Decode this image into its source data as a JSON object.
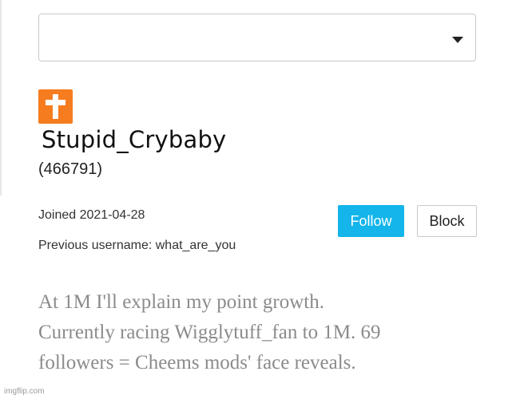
{
  "dropdown": {
    "value": ""
  },
  "profile": {
    "avatar_icon": "cross-icon",
    "avatar_color": "#f57c1f",
    "username": "Stupid_Crybaby",
    "user_id": "(466791)",
    "joined": "Joined 2021-04-28",
    "previous_username": "Previous username: what_are_you"
  },
  "actions": {
    "follow_label": "Follow",
    "follow_color": "#13b5ea",
    "block_label": "Block"
  },
  "bio": {
    "lines": [
      "At 1M I'll explain my point growth.",
      "Currently racing Wigglytuff_fan to 1M. 69",
      "followers = Cheems mods' face reveals."
    ]
  },
  "watermark": "imgflip.com"
}
